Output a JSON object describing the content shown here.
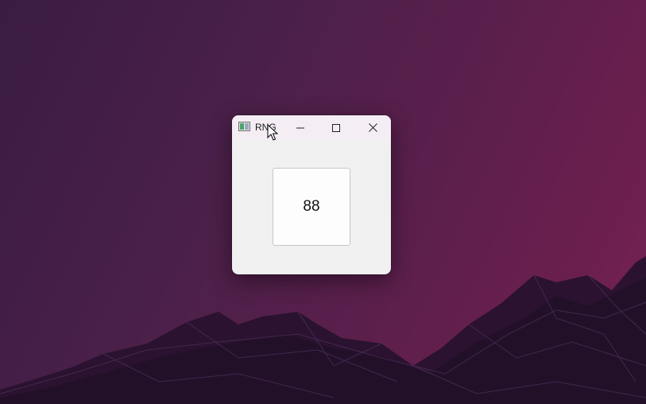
{
  "window": {
    "title": "RNG",
    "icon": "app-window-icon",
    "controls": {
      "minimize_icon": "minimize-icon",
      "maximize_icon": "maximize-icon",
      "close_icon": "close-icon"
    }
  },
  "main": {
    "number_value": "88"
  },
  "colors": {
    "wallpaper": "#5a1f4c",
    "window_bg": "#f0f0f0",
    "titlebar_bg": "#f4eef4",
    "button_bg": "#fdfdfd"
  }
}
